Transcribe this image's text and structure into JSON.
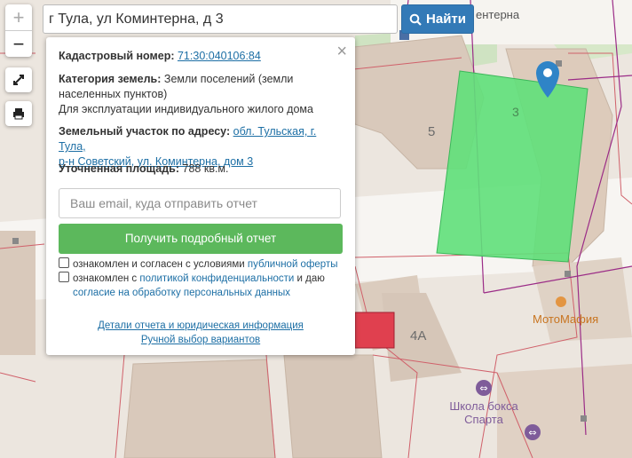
{
  "search": {
    "value": "г Тула, ул Коминтерна, д 3",
    "button_label": "Найти"
  },
  "map": {
    "street_label": "ентерна",
    "building_numbers": [
      "5",
      "3",
      "4А"
    ],
    "poi": [
      {
        "name": "МотоМафия",
        "color": "#c8741f"
      },
      {
        "name": "Школа бокса\nСпарта",
        "color": "#7f5c9a"
      }
    ],
    "highlight_color": "#5fe07a"
  },
  "popup": {
    "cadastral_label": "Кадастровый номер:",
    "cadastral_value": "71:30:040106:84",
    "category_label": "Категория земель:",
    "category_value": "Земли поселений (земли населенных пунктов)",
    "purpose": "Для эксплуатации индивидуального жилого дома",
    "address_label": "Земельный участок по адресу:",
    "address_line1": "обл. Тульская, г. Тула,",
    "address_line2": "р-н Советский, ул. Коминтерна, дом 3",
    "area_label": "Уточненная площадь:",
    "area_value": "788 кв.м.",
    "email_placeholder": "Ваш email, куда отправить отчет",
    "report_button": "Получить подробный отчет",
    "consent1_text": "ознакомлен и согласен с условиями",
    "consent1_link": "публичной оферты",
    "consent2_text": "ознакомлен с",
    "consent2_link": "политикой конфиденциальности",
    "consent2_and": "и даю",
    "consent2_link2": "согласие на обработку персональных данных",
    "details_link": "Детали отчета и юридическая информация",
    "manual_link": "Ручной выбор вариантов"
  }
}
